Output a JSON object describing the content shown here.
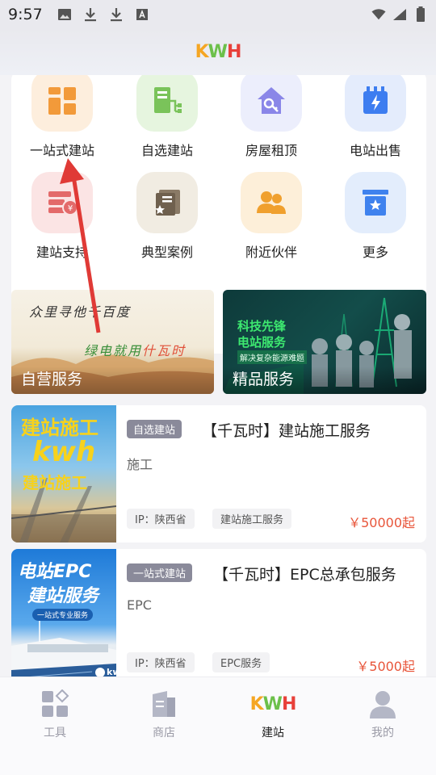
{
  "status_bar": {
    "time": "9:57",
    "left_icons": [
      "image-icon",
      "download-icon",
      "download-icon",
      "font-icon"
    ],
    "right_icons": [
      "wifi-icon",
      "signal-icon",
      "battery-icon"
    ]
  },
  "header": {
    "logo": {
      "k": "K",
      "w": "W",
      "h": "H"
    }
  },
  "grid": {
    "items": [
      {
        "label": "一站式建站",
        "icon": "layout-icon",
        "bg": "#fdeedd",
        "color": "#f29a3a"
      },
      {
        "label": "自选建站",
        "icon": "org-chart-icon",
        "bg": "#e6f5df",
        "color": "#7ac35a"
      },
      {
        "label": "房屋租顶",
        "icon": "house-key-icon",
        "bg": "#eceefc",
        "color": "#8a86e8"
      },
      {
        "label": "电站出售",
        "icon": "battery-station-icon",
        "bg": "#e4ecfc",
        "color": "#3d7df0"
      },
      {
        "label": "建站支持",
        "icon": "money-stack-icon",
        "bg": "#fbe4e4",
        "color": "#e36a6a"
      },
      {
        "label": "典型案例",
        "icon": "book-star-icon",
        "bg": "#f1ece2",
        "color": "#8a7a66"
      },
      {
        "label": "附近伙伴",
        "icon": "people-icon",
        "bg": "#fdefd9",
        "color": "#f0a02e"
      },
      {
        "label": "更多",
        "icon": "box-star-icon",
        "bg": "#e3edfc",
        "color": "#3f82ee"
      }
    ]
  },
  "banners": [
    {
      "label": "自营服务",
      "line1": "众里寻他千百度",
      "line2_prefix": "绿电就用",
      "line2_highlight": "什瓦时"
    },
    {
      "label": "精品服务",
      "line1": "科技先锋",
      "line2": "电站服务",
      "line3": "解决复杂能源难题"
    }
  ],
  "services": [
    {
      "badge": "自选建站",
      "title": "【千瓦时】建站施工服务",
      "subtitle": "施工",
      "tags": [
        "IP：陕西省",
        "建站施工服务"
      ],
      "price": "￥50000起",
      "thumb": {
        "line1": "建站施工",
        "line2": "kwh",
        "line3": "建站施工"
      }
    },
    {
      "badge": "一站式建站",
      "title": "【千瓦时】EPC总承包服务",
      "subtitle": "EPC",
      "tags": [
        "IP：陕西省",
        "EPC服务"
      ],
      "price": "￥5000起",
      "thumb": {
        "line1": "电站EPC",
        "line2": "建站服务",
        "line3": "一站式专业服务",
        "brand": "kw"
      }
    }
  ],
  "tabbar": {
    "tabs": [
      {
        "label": "工具",
        "icon": "tools-grid-icon",
        "active": false
      },
      {
        "label": "商店",
        "icon": "store-icon",
        "active": false
      },
      {
        "label": "建站",
        "icon": "kwh-logo-icon",
        "active": true
      },
      {
        "label": "我的",
        "icon": "user-icon",
        "active": false
      }
    ]
  },
  "colors": {
    "accent_price": "#e8553a",
    "badge_bg": "#8a8a9a",
    "annotation_arrow": "#e03a36"
  }
}
